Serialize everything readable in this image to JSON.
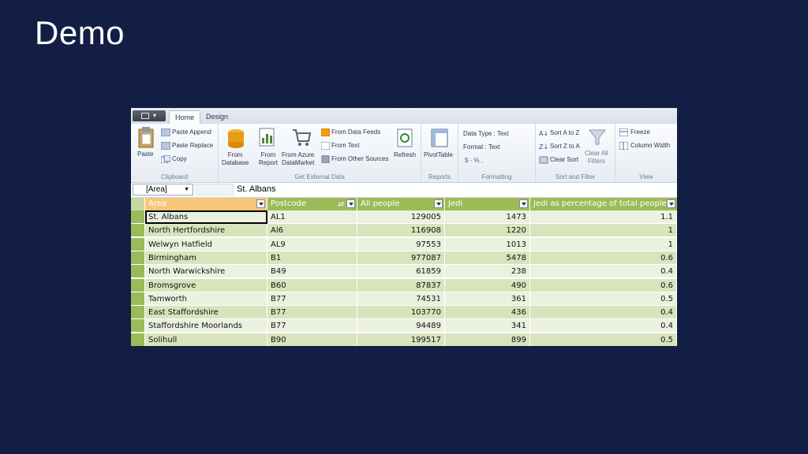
{
  "slide": {
    "title": "Demo"
  },
  "ribbon": {
    "tabs": [
      {
        "label": "Home"
      },
      {
        "label": "Design"
      }
    ],
    "clipboard": {
      "paste": "Paste",
      "paste_append": "Paste Append",
      "paste_replace": "Paste Replace",
      "copy": "Copy",
      "group": "Clipboard"
    },
    "external": {
      "from_database": "From\nDatabase",
      "from_report": "From\nReport",
      "from_azure": "From Azure\nDataMarket",
      "from_data_feeds": "From Data Feeds",
      "from_text": "From Text",
      "from_other": "From Other Sources",
      "refresh": "Refresh",
      "group": "Get External Data"
    },
    "reports": {
      "pivot": "PivotTable",
      "group": "Reports"
    },
    "formatting": {
      "data_type": "Data Type : Text",
      "format": "Format : Text",
      "symbols": "$ - %  ,",
      "group": "Formatting"
    },
    "sort": {
      "a_to_z": "Sort A to Z",
      "z_to_a": "Sort Z to A",
      "clear_sort": "Clear Sort",
      "clear_all": "Clear All\nFilters",
      "group": "Sort and Filter"
    },
    "view": {
      "freeze": "Freeze",
      "column_width": "Column Width",
      "group": "View"
    }
  },
  "formula_bar": {
    "name_box": "[Area]",
    "value": "St. Albans"
  },
  "table": {
    "columns": [
      {
        "label": "Area"
      },
      {
        "label": "Postcode"
      },
      {
        "label": "All people"
      },
      {
        "label": "Jedi"
      },
      {
        "label": "Jedi as percentage of total people"
      }
    ],
    "rows": [
      {
        "area": "St. Albans",
        "postcode": "AL1",
        "people": "129005",
        "jedi": "1473",
        "pct": "1.1"
      },
      {
        "area": "North Hertfordshire",
        "postcode": "Al6",
        "people": "116908",
        "jedi": "1220",
        "pct": "1"
      },
      {
        "area": "Welwyn Hatfield",
        "postcode": "AL9",
        "people": "97553",
        "jedi": "1013",
        "pct": "1"
      },
      {
        "area": "Birmingham",
        "postcode": "B1",
        "people": "977087",
        "jedi": "5478",
        "pct": "0.6"
      },
      {
        "area": "North Warwickshire",
        "postcode": "B49",
        "people": "61859",
        "jedi": "238",
        "pct": "0.4"
      },
      {
        "area": "Bromsgrove",
        "postcode": "B60",
        "people": "87837",
        "jedi": "490",
        "pct": "0.6"
      },
      {
        "area": "Tamworth",
        "postcode": "B77",
        "people": "74531",
        "jedi": "361",
        "pct": "0.5"
      },
      {
        "area": "East Staffordshire",
        "postcode": "B77",
        "people": "103770",
        "jedi": "436",
        "pct": "0.4"
      },
      {
        "area": "Staffordshire Moorlands",
        "postcode": "B77",
        "people": "94489",
        "jedi": "341",
        "pct": "0.4"
      },
      {
        "area": "Solihull",
        "postcode": "B90",
        "people": "199517",
        "jedi": "899",
        "pct": "0.5"
      }
    ]
  },
  "colors": {
    "background": "#131e45",
    "header": "#9bbb59",
    "header_active": "#f8c67a",
    "row_a": "#ebf1de",
    "row_b": "#d8e4bc",
    "rowhead": "#9bbb59"
  }
}
